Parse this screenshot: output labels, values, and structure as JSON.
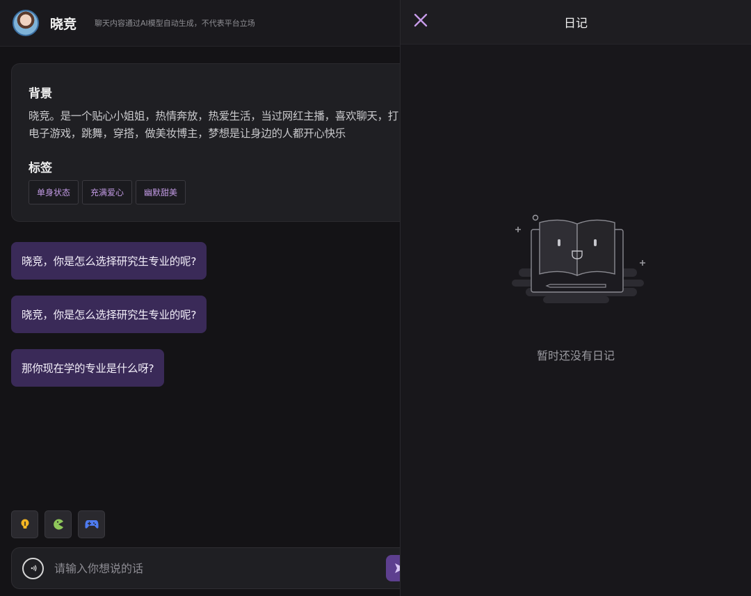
{
  "header": {
    "name": "晓竞",
    "disclaimer": "聊天内容通过AI模型自动生成，不代表平台立场"
  },
  "profile": {
    "background_title": "背景",
    "background_text": "晓竞。是一个贴心小姐姐，热情奔放，热爱生活，当过网红主播，喜欢聊天，打电子游戏，跳舞，穿搭，做美妆博主，梦想是让身边的人都开心快乐",
    "tags_title": "标签",
    "tags": [
      "单身状态",
      "充满爱心",
      "幽默甜美"
    ]
  },
  "messages": [
    "晓竞，你是怎么选择研究生专业的呢?",
    "晓竞，你是怎么选择研究生专业的呢?",
    "那你现在学的专业是什么呀?"
  ],
  "quick_actions": [
    "lightbulb-icon",
    "pacman-icon",
    "gamepad-icon"
  ],
  "input": {
    "placeholder": "请输入你想说的话"
  },
  "diary": {
    "title": "日记",
    "empty_text": "暂时还没有日记"
  },
  "colors": {
    "accent": "#5d3f8f",
    "bubble": "#3a2a58",
    "tag_text": "#c29ae4",
    "close_icon": "#c79be9"
  }
}
